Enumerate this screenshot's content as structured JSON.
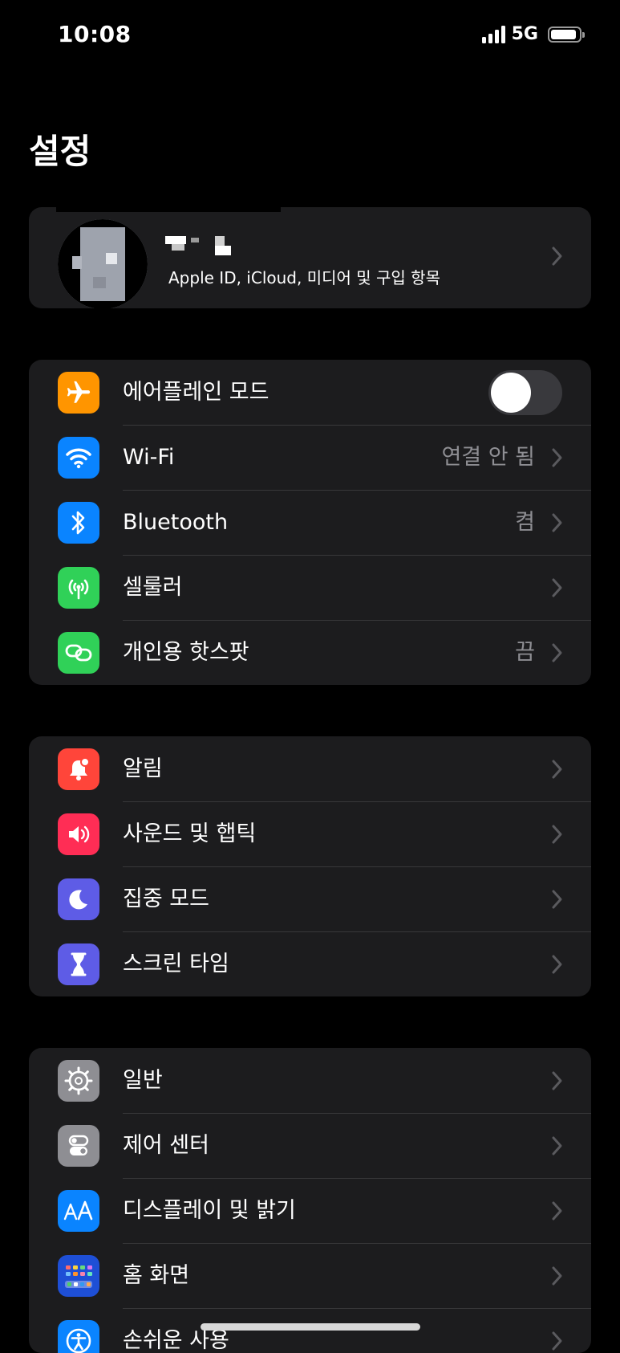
{
  "status_bar": {
    "time": "10:08",
    "network": "5G",
    "signal_bars": 4,
    "battery_level": 0.9
  },
  "page_title": "설정",
  "profile": {
    "subtitle": "Apple ID, iCloud, 미디어 및 구입 항목",
    "avatar_icon": "redacted-avatar",
    "name_redacted": true
  },
  "group_connectivity": {
    "airplane": {
      "label": "에어플레인 모드",
      "icon": "airplane-icon",
      "color": "#ff9500",
      "toggle_on": false
    },
    "wifi": {
      "label": "Wi-Fi",
      "value": "연결 안 됨",
      "icon": "wifi-icon",
      "color": "#0a84ff"
    },
    "bluetooth": {
      "label": "Bluetooth",
      "value": "켬",
      "icon": "bluetooth-icon",
      "color": "#0a84ff"
    },
    "cellular": {
      "label": "셀룰러",
      "icon": "cellular-antenna-icon",
      "color": "#30d158"
    },
    "hotspot": {
      "label": "개인용 핫스팟",
      "value": "끔",
      "icon": "hotspot-link-icon",
      "color": "#30d158"
    }
  },
  "group_notifications": {
    "notifications": {
      "label": "알림",
      "icon": "bell-badge-icon",
      "color": "#ff453a"
    },
    "sounds": {
      "label": "사운드 및 햅틱",
      "icon": "speaker-icon",
      "color": "#ff2d55"
    },
    "focus": {
      "label": "집중 모드",
      "icon": "moon-icon",
      "color": "#5e5ce6"
    },
    "screen_time": {
      "label": "스크린 타임",
      "icon": "hourglass-icon",
      "color": "#5e5ce6"
    }
  },
  "group_general": {
    "general": {
      "label": "일반",
      "icon": "gear-icon",
      "color": "#8e8e93"
    },
    "control_center": {
      "label": "제어 센터",
      "icon": "toggles-icon",
      "color": "#8e8e93"
    },
    "display": {
      "label": "디스플레이 및 밝기",
      "icon": "text-size-icon",
      "color": "#0a84ff"
    },
    "home_screen": {
      "label": "홈 화면",
      "icon": "app-grid-icon",
      "color": "#1e4fd6"
    },
    "accessibility": {
      "label": "손쉬운 사용",
      "icon": "accessibility-icon",
      "color": "#0a84ff"
    }
  }
}
